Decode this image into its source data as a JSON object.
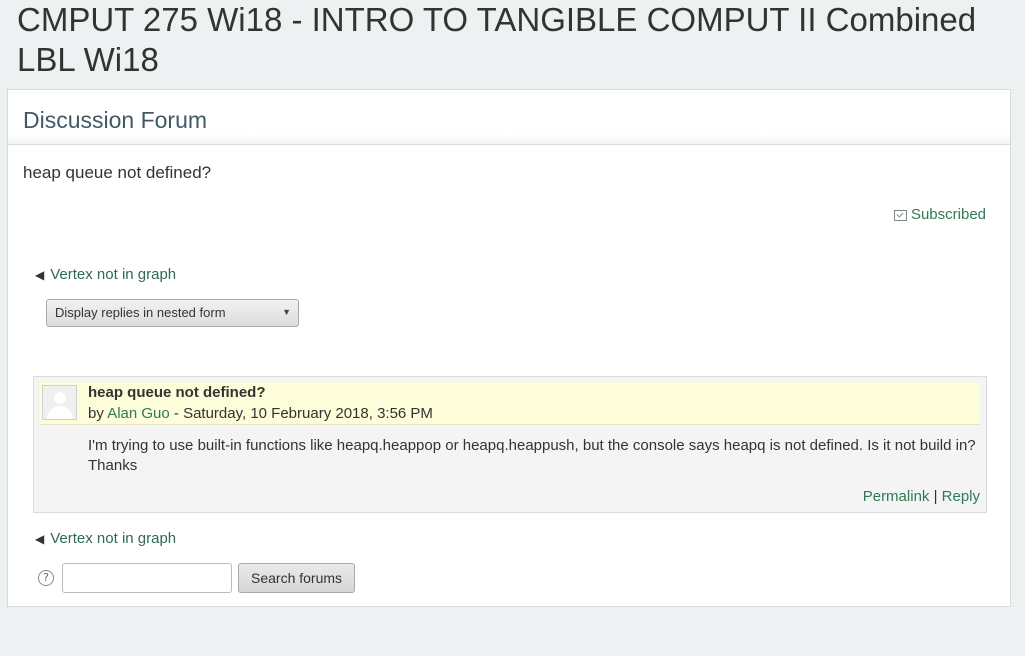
{
  "page": {
    "course_title": "CMPUT 275 Wi18 - INTRO TO TANGIBLE COMPUT II Combined LBL Wi18"
  },
  "forum": {
    "block_title": "Discussion Forum",
    "discussion_name": "heap queue not defined?",
    "subscribe_label": "Subscribed",
    "prev_discussion_label": "Vertex not in graph",
    "display_mode_selected": "Display replies in nested form",
    "post": {
      "subject": "heap queue not defined?",
      "by_prefix": "by ",
      "author": "Alan Guo",
      "date_suffix": " - Saturday, 10 February 2018, 3:56 PM",
      "body": "I'm trying to use built-in functions like heapq.heappop or heapq.heappush, but the console says heapq is not defined. Is it not build in? Thanks",
      "permalink_label": "Permalink",
      "separator": " | ",
      "reply_label": "Reply"
    },
    "search": {
      "help_glyph": "?",
      "input_value": "",
      "button_label": "Search forums"
    }
  },
  "icons": {
    "subscribed": "envelope-check-icon",
    "prev_arrow": "left-triangle-icon",
    "help": "help-circle-icon",
    "avatar": "default-user-avatar-icon"
  },
  "colors": {
    "link": "#2f7a56",
    "post_header_bg": "#fdfdd9",
    "page_bg": "#eef1f1"
  }
}
